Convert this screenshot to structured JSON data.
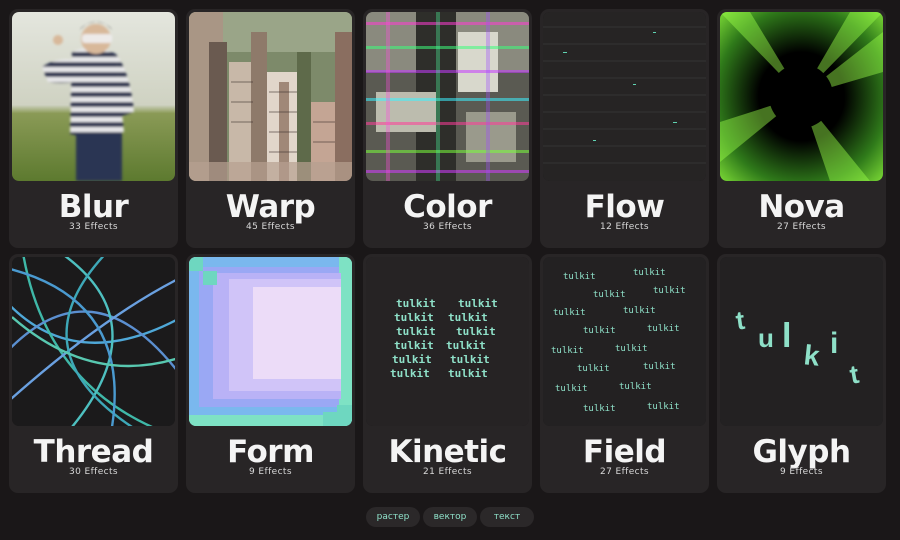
{
  "cards": [
    {
      "title": "Blur",
      "count": "33 Effects",
      "thumbnail": "photo-boy-blur"
    },
    {
      "title": "Warp",
      "count": "45 Effects",
      "thumbnail": "warped-buildings"
    },
    {
      "title": "Color",
      "count": "36 Effects",
      "thumbnail": "color-glitch"
    },
    {
      "title": "Flow",
      "count": "12 Effects",
      "thumbnail": "dark-flow-lines"
    },
    {
      "title": "Nova",
      "count": "27 Effects",
      "thumbnail": "green-rays"
    },
    {
      "title": "Thread",
      "count": "30 Effects",
      "thumbnail": "thread-curves"
    },
    {
      "title": "Form",
      "count": "9 Effects",
      "thumbnail": "pixel-squares"
    },
    {
      "title": "Kinetic",
      "count": "21 Effects",
      "thumbnail": "kinetic-text"
    },
    {
      "title": "Field",
      "count": "27 Effects",
      "thumbnail": "field-text"
    },
    {
      "title": "Glyph",
      "count": "9 Effects",
      "thumbnail": "glyph-text"
    }
  ],
  "glyph_text": [
    "t",
    "u",
    "l",
    "k",
    "i",
    "t"
  ],
  "kinetic_text": "tulkit",
  "tabs": [
    {
      "label": "растер"
    },
    {
      "label": "вектор"
    },
    {
      "label": "текст"
    }
  ],
  "colors": {
    "background": "#1a1718",
    "card": "#282526",
    "accent": "#8ee0c8",
    "text": "#f4f4f4"
  }
}
